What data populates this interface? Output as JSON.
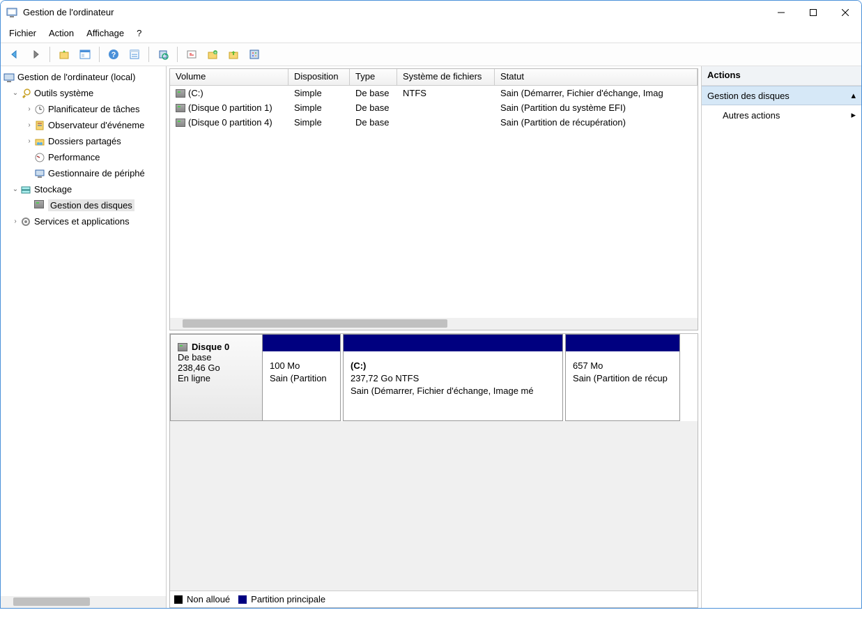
{
  "title": "Gestion de l'ordinateur",
  "menu": {
    "file": "Fichier",
    "action": "Action",
    "view": "Affichage",
    "help": "?"
  },
  "tree": {
    "root": "Gestion de l'ordinateur (local)",
    "tools": "Outils système",
    "tools_items": {
      "scheduler": "Planificateur de tâches",
      "eventviewer": "Observateur d'événeme",
      "shared": "Dossiers partagés",
      "perf": "Performance",
      "devmgr": "Gestionnaire de périphé"
    },
    "storage": "Stockage",
    "diskmgmt": "Gestion des disques",
    "services": "Services et applications"
  },
  "columns": {
    "volume": "Volume",
    "layout": "Disposition",
    "type": "Type",
    "fs": "Système de fichiers",
    "status": "Statut"
  },
  "volumes": [
    {
      "name": "(C:)",
      "layout": "Simple",
      "type": "De base",
      "fs": "NTFS",
      "status": "Sain (Démarrer, Fichier d'échange, Imag"
    },
    {
      "name": "(Disque 0 partition 1)",
      "layout": "Simple",
      "type": "De base",
      "fs": "",
      "status": "Sain (Partition du système EFI)"
    },
    {
      "name": "(Disque 0 partition 4)",
      "layout": "Simple",
      "type": "De base",
      "fs": "",
      "status": "Sain (Partition de récupération)"
    }
  ],
  "disk": {
    "name": "Disque 0",
    "type": "De base",
    "size": "238,46 Go",
    "status": "En ligne",
    "partitions": [
      {
        "title": "",
        "size": "100 Mo",
        "status": "Sain (Partition "
      },
      {
        "title": "(C:)",
        "size": "237,72 Go NTFS",
        "status": "Sain (Démarrer, Fichier d'échange, Image mé"
      },
      {
        "title": "",
        "size": "657 Mo",
        "status": "Sain (Partition de récup"
      }
    ]
  },
  "legend": {
    "unalloc": "Non alloué",
    "primary": "Partition principale"
  },
  "actions": {
    "header": "Actions",
    "section": "Gestion des disques",
    "more": "Autres actions"
  }
}
